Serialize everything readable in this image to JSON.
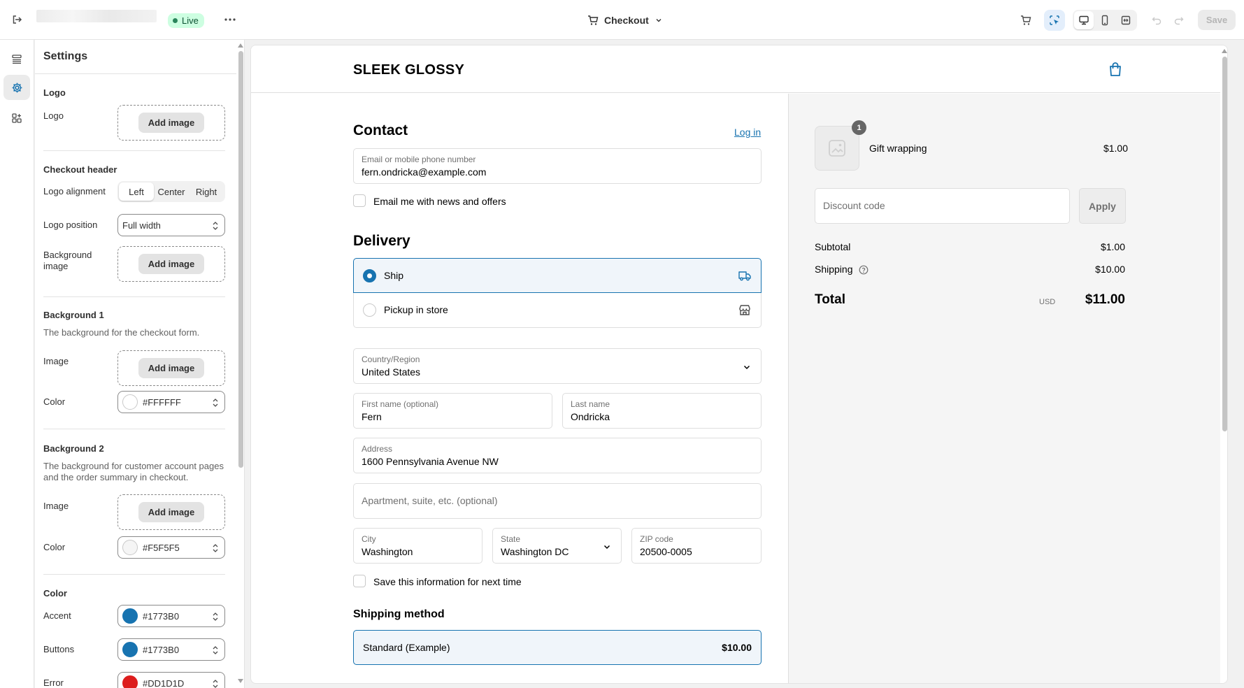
{
  "topbar": {
    "live_label": "Live",
    "page_selector_label": "Checkout",
    "save_label": "Save"
  },
  "settings": {
    "title": "Settings",
    "logo_section": {
      "heading": "Logo",
      "label": "Logo",
      "add_image": "Add image"
    },
    "checkout_header": {
      "heading": "Checkout header",
      "logo_alignment_label": "Logo alignment",
      "alignment_options": [
        "Left",
        "Center",
        "Right"
      ],
      "alignment_selected": "Left",
      "logo_position_label": "Logo position",
      "logo_position_value": "Full width",
      "background_image_label": "Background image",
      "add_image": "Add image"
    },
    "background1": {
      "heading": "Background 1",
      "description": "The background for the checkout form.",
      "image_label": "Image",
      "add_image": "Add image",
      "color_label": "Color",
      "color_value": "#FFFFFF"
    },
    "background2": {
      "heading": "Background 2",
      "description": "The background for customer account pages and the order summary in checkout.",
      "image_label": "Image",
      "add_image": "Add image",
      "color_label": "Color",
      "color_value": "#F5F5F5"
    },
    "color_section": {
      "heading": "Color",
      "accent_label": "Accent",
      "accent_value": "#1773B0",
      "buttons_label": "Buttons",
      "buttons_value": "#1773B0",
      "error_label": "Error",
      "error_value": "#DD1D1D"
    }
  },
  "colors": {
    "accent": "#1773b0",
    "error": "#dd1d1d",
    "bg2": "#f5f5f5",
    "live_bg": "#cdfee1"
  },
  "checkout": {
    "brand": "SLEEK GLOSSY",
    "contact": {
      "heading": "Contact",
      "login_link": "Log in",
      "email_label": "Email or mobile phone number",
      "email_value": "fern.ondricka@example.com",
      "news_checkbox": "Email me with news and offers"
    },
    "delivery": {
      "heading": "Delivery",
      "ship_label": "Ship",
      "pickup_label": "Pickup in store",
      "country_label": "Country/Region",
      "country_value": "United States",
      "first_name_label": "First name (optional)",
      "first_name_value": "Fern",
      "last_name_label": "Last name",
      "last_name_value": "Ondricka",
      "address_label": "Address",
      "address_value": "1600 Pennsylvania Avenue NW",
      "apartment_placeholder": "Apartment, suite, etc. (optional)",
      "city_label": "City",
      "city_value": "Washington",
      "state_label": "State",
      "state_value": "Washington DC",
      "zip_label": "ZIP code",
      "zip_value": "20500-0005",
      "save_checkbox": "Save this information for next time"
    },
    "shipping_method": {
      "heading": "Shipping method",
      "option_label": "Standard (Example)",
      "option_price": "$10.00"
    }
  },
  "summary": {
    "item_quantity": "1",
    "item_name": "Gift wrapping",
    "item_price": "$1.00",
    "discount_placeholder": "Discount code",
    "apply_label": "Apply",
    "subtotal_label": "Subtotal",
    "subtotal_value": "$1.00",
    "shipping_label": "Shipping",
    "shipping_value": "$10.00",
    "total_label": "Total",
    "currency": "USD",
    "total_value": "$11.00"
  }
}
